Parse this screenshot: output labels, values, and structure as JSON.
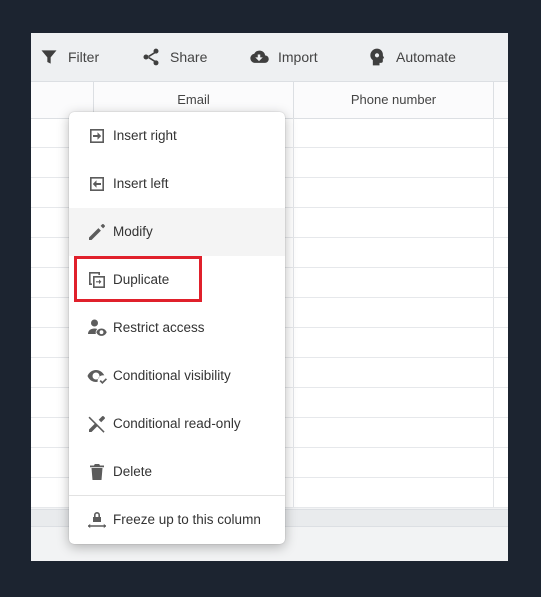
{
  "toolbar": {
    "filter": "Filter",
    "share": "Share",
    "import": "Import",
    "automate": "Automate"
  },
  "grid": {
    "columns": [
      "Email",
      "Phone number"
    ]
  },
  "context_menu": {
    "items": [
      {
        "label": "Insert right",
        "icon": "insert-right-icon"
      },
      {
        "label": "Insert left",
        "icon": "insert-left-icon"
      },
      {
        "label": "Modify",
        "icon": "pencil-icon"
      },
      {
        "label": "Duplicate",
        "icon": "duplicate-icon"
      },
      {
        "label": "Restrict access",
        "icon": "user-eye-icon"
      },
      {
        "label": "Conditional visibility",
        "icon": "eye-check-icon"
      },
      {
        "label": "Conditional read-only",
        "icon": "pencil-off-icon"
      },
      {
        "label": "Delete",
        "icon": "trash-icon"
      },
      {
        "label": "Freeze up to this column",
        "icon": "freeze-lock-icon"
      }
    ],
    "hovered": "Modify",
    "highlighted": "Duplicate"
  },
  "colors": {
    "backdrop": "#1c2430",
    "highlight": "#e0202b",
    "icon": "#5c5c5c"
  }
}
